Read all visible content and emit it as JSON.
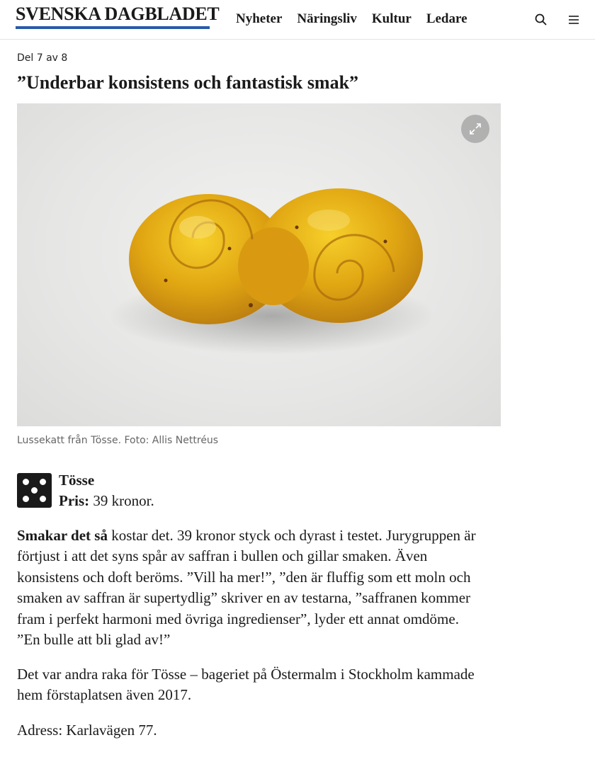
{
  "header": {
    "logo_text": "SVENSKA DAGBLADET",
    "brand_color": "#2b5aa8",
    "nav": [
      {
        "label": "Nyheter"
      },
      {
        "label": "Näringsliv"
      },
      {
        "label": "Kultur"
      },
      {
        "label": "Ledare"
      }
    ],
    "icons": [
      "search-icon",
      "menu-icon"
    ]
  },
  "article": {
    "part_label": "Del 7 av 8",
    "headline": "”Underbar konsistens och fantastisk smak”",
    "photo": {
      "subject": "lussekatt",
      "expand_icon": "expand-icon"
    },
    "caption": "Lussekatt från Tösse. Foto: Allis Nettréus",
    "rating": {
      "dice_value": 5
    },
    "bakery": "Tösse",
    "price_label": "Pris:",
    "price_value": " 39 kronor.",
    "paragraph1_lead": "Smakar det så",
    "paragraph1_rest": " kostar det. 39 kronor styck och dyrast i testet. Jurygruppen är förtjust i att det syns spår av saffran i bullen och gillar smaken. Även konsistens och doft beröms. ”Vill ha mer!”, ”den är fluffig som ett moln och smaken av saffran är supertydlig” skriver en av testarna, ”saffranen kommer fram i perfekt harmoni med övriga ingredienser”, lyder ett annat omdöme. ”En bulle att bli glad av!”",
    "paragraph2": "Det var andra raka för Tösse – bageriet på Östermalm i Stockholm kammade hem förstaplatsen även 2017.",
    "paragraph3": "Adress: Karlavägen 77."
  }
}
